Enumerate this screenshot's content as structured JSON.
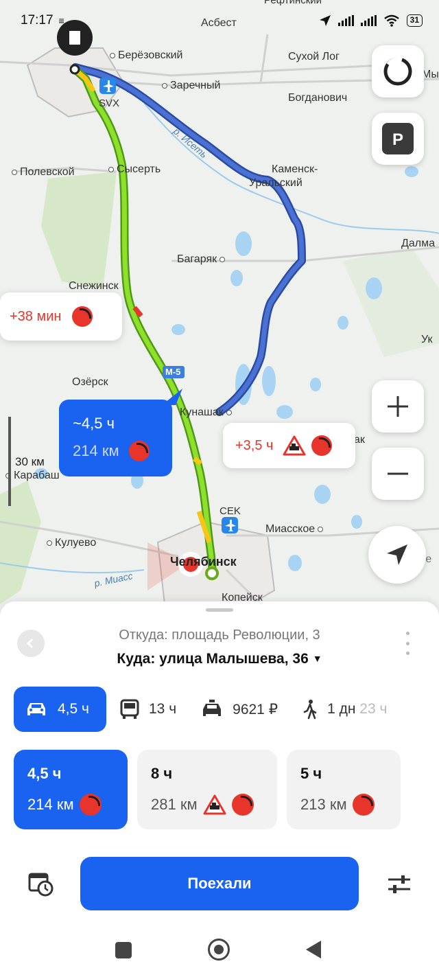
{
  "status_bar": {
    "time": "17:17",
    "battery": "31"
  },
  "map": {
    "places": {
      "asbest": "Асбест",
      "refinsky": "Рефтинский",
      "beryozovsky": "Берёзовский",
      "sukhoi_log": "Сухой Лог",
      "zarechny": "Заречный",
      "bogdanovich": "Богданович",
      "svx": "SVX",
      "polevskoy": "Полевской",
      "sysert": "Сысерть",
      "kamensk_line1": "Каменск-",
      "kamensk_line2": "Уральский",
      "dalmatovo": "Далма",
      "bagaryak": "Багаряк",
      "snezhinsk": "Снежинск",
      "uk": "Ук",
      "ozersk": "Озёрск",
      "kunashak": "Кунашак",
      "karabash": "Карабаш",
      "kulevo": "Кулуево",
      "cek": "CEK",
      "miasskoe": "Миасское",
      "chelyabinsk": "Челябинск",
      "kopeisk": "Копейск",
      "myshkino": "Мыш",
      "ak": "ак",
      "luchy": "Лучье",
      "m5": "M-5"
    },
    "rivers": {
      "iset": "р. Исеть",
      "miass": "р. Миасс"
    },
    "scale_label": "30 км",
    "bubbles": {
      "plus38": "+38 мин",
      "main_time": "~4,5 ч",
      "main_dist": "214 км",
      "plus35": "+3,5 ч"
    }
  },
  "sheet": {
    "from": "Откуда: площадь Революции, 3",
    "to": "Куда: улица Малышева, 36",
    "modes": {
      "car": "4,5 ч",
      "bus": "13 ч",
      "taxi": "9621 ₽",
      "walk_a": "1 дн",
      "walk_b": "23 ч"
    },
    "variants": [
      {
        "time": "4,5 ч",
        "dist": "214 км"
      },
      {
        "time": "8 ч",
        "dist": "281 км"
      },
      {
        "time": "5 ч",
        "dist": "213 км"
      }
    ],
    "go_label": "Поехали"
  },
  "colors": {
    "accent": "#1a63f0",
    "traffic_red": "#e8352c",
    "route_green": "#7ed321",
    "route_blue": "#3a62c4"
  }
}
